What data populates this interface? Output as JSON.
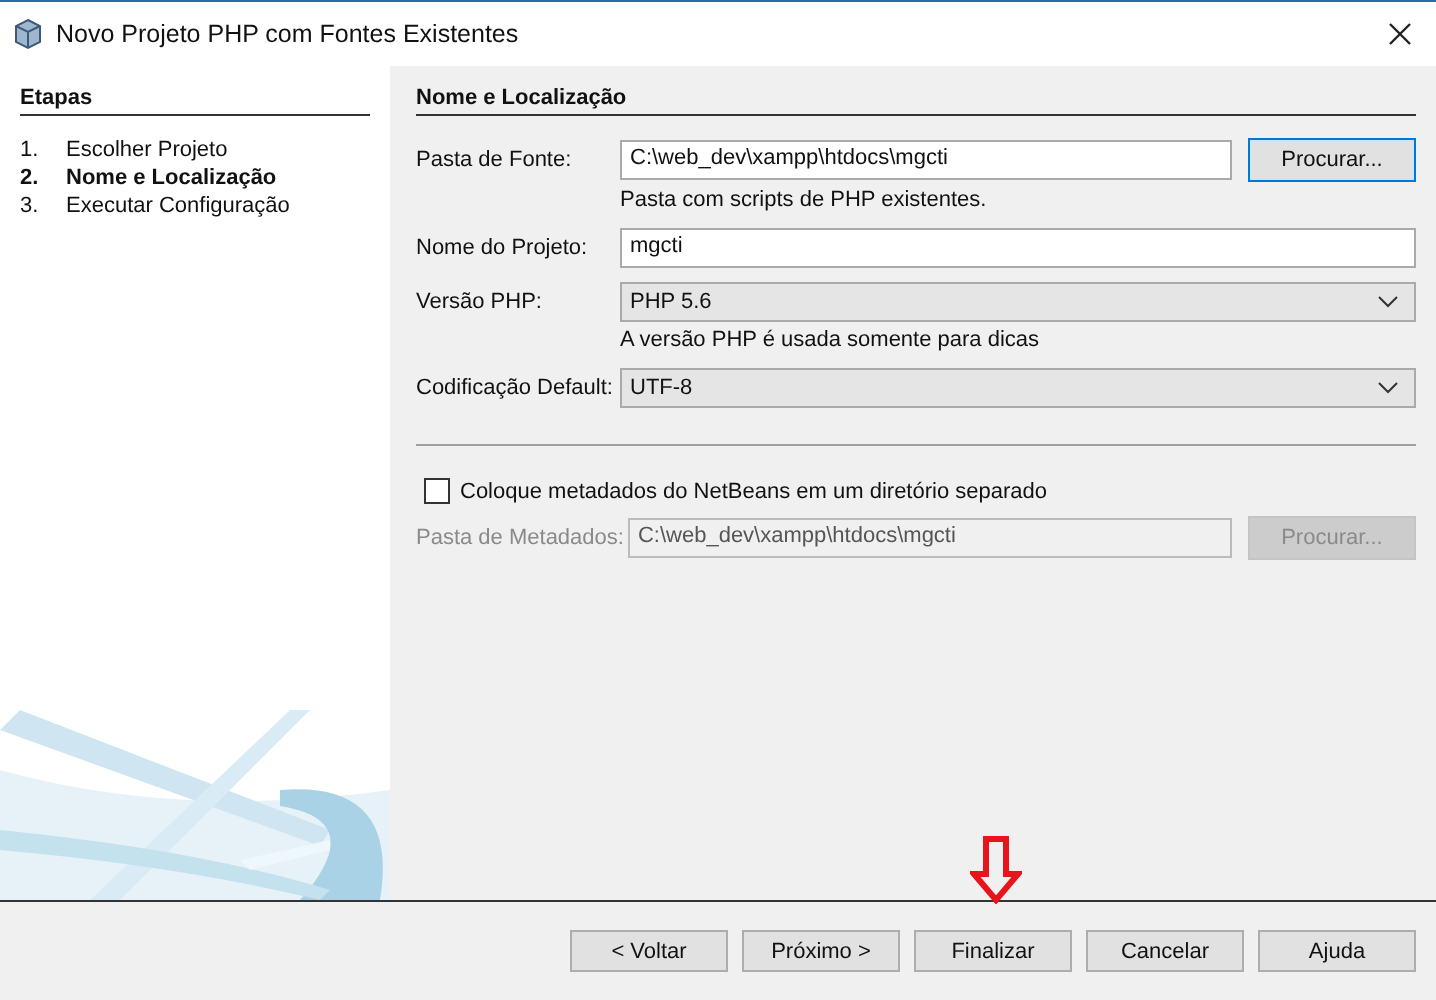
{
  "window": {
    "title": "Novo Projeto PHP com Fontes Existentes"
  },
  "steps_panel": {
    "title": "Etapas",
    "steps": [
      {
        "number": "1.",
        "label": "Escolher Projeto",
        "selected": false
      },
      {
        "number": "2.",
        "label": "Nome e Localização",
        "selected": true
      },
      {
        "number": "3.",
        "label": "Executar Configuração",
        "selected": false
      }
    ]
  },
  "form": {
    "title": "Nome e Localização",
    "source_folder": {
      "label": "Pasta de Fonte:",
      "value": "C:\\web_dev\\xampp\\htdocs\\mgcti",
      "button": {
        "label": "Procurar...",
        "focused": true
      },
      "hint": "Pasta com scripts de PHP existentes."
    },
    "project_name": {
      "label": "Nome do Projeto:",
      "value": "mgcti"
    },
    "php_version": {
      "label": "Versão PHP:",
      "value": "PHP 5.6",
      "hint": "A versão PHP é usada somente para dicas"
    },
    "encoding": {
      "label": "Codificação Default:",
      "value": "UTF-8"
    },
    "metadata": {
      "checkbox_label": "Coloque metadados do NetBeans em um diretório separado",
      "checked": false,
      "label": "Pasta de Metadados:",
      "value": "C:\\web_dev\\xampp\\htdocs\\mgcti",
      "button": {
        "label": "Procurar...",
        "focused": false
      },
      "disabled": true
    }
  },
  "buttons": [
    {
      "label": "< Voltar"
    },
    {
      "label": "Próximo >"
    },
    {
      "label": "Finalizar"
    },
    {
      "label": "Cancelar"
    },
    {
      "label": "Ajuda"
    }
  ]
}
